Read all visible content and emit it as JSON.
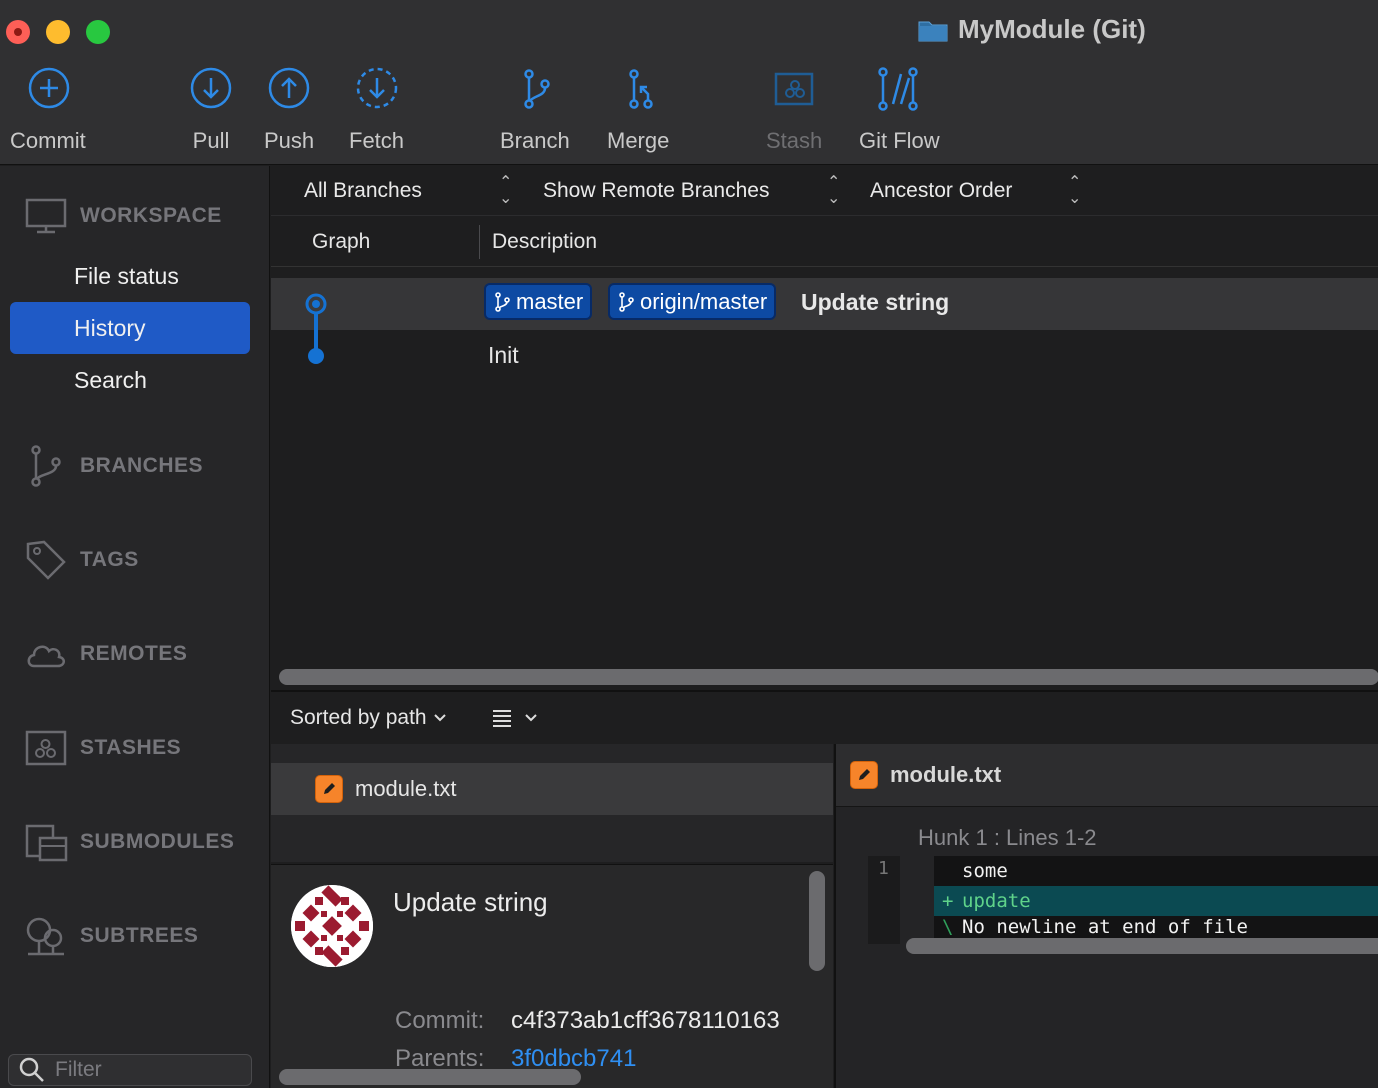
{
  "window": {
    "title": "MyModule (Git)"
  },
  "toolbar": {
    "commit": "Commit",
    "pull": "Pull",
    "push": "Push",
    "fetch": "Fetch",
    "branch": "Branch",
    "merge": "Merge",
    "stash": "Stash",
    "git_flow": "Git Flow"
  },
  "sidebar": {
    "workspace": "WORKSPACE",
    "items": [
      "File status",
      "History",
      "Search"
    ],
    "active_item": "History",
    "branches": "BRANCHES",
    "tags": "TAGS",
    "remotes": "REMOTES",
    "stashes": "STASHES",
    "submodules": "SUBMODULES",
    "subtrees": "SUBTREES",
    "filter_placeholder": "Filter"
  },
  "history": {
    "branch_filter": "All Branches",
    "remote_filter": "Show Remote Branches",
    "order": "Ancestor Order",
    "columns": {
      "graph": "Graph",
      "description": "Description"
    },
    "commits": [
      {
        "badges": [
          "master",
          "origin/master"
        ],
        "message": "Update string",
        "selected": true
      },
      {
        "badges": [],
        "message": "Init",
        "selected": false
      }
    ]
  },
  "files": {
    "sort": "Sorted by path",
    "items": [
      "module.txt"
    ]
  },
  "commit_details": {
    "subject": "Update string",
    "commit_label": "Commit:",
    "commit_hash": "c4f373ab1cff3678110163",
    "parents_label": "Parents:",
    "parents_hash": "3f0dbcb741"
  },
  "diff": {
    "file": "module.txt",
    "hunk": "Hunk 1 : Lines 1-2",
    "line_number": "1",
    "lines": [
      {
        "mark": "",
        "text": "some"
      },
      {
        "mark": "+",
        "text": "update"
      },
      {
        "mark": "\\",
        "text": "No newline at end of file"
      }
    ]
  },
  "colors": {
    "accent": "#1f5ac6",
    "badge": "#0d4aa3",
    "icon_blue": "#2e8ae6",
    "added_line": "#0b4a52",
    "file_modified": "#f6842a"
  }
}
